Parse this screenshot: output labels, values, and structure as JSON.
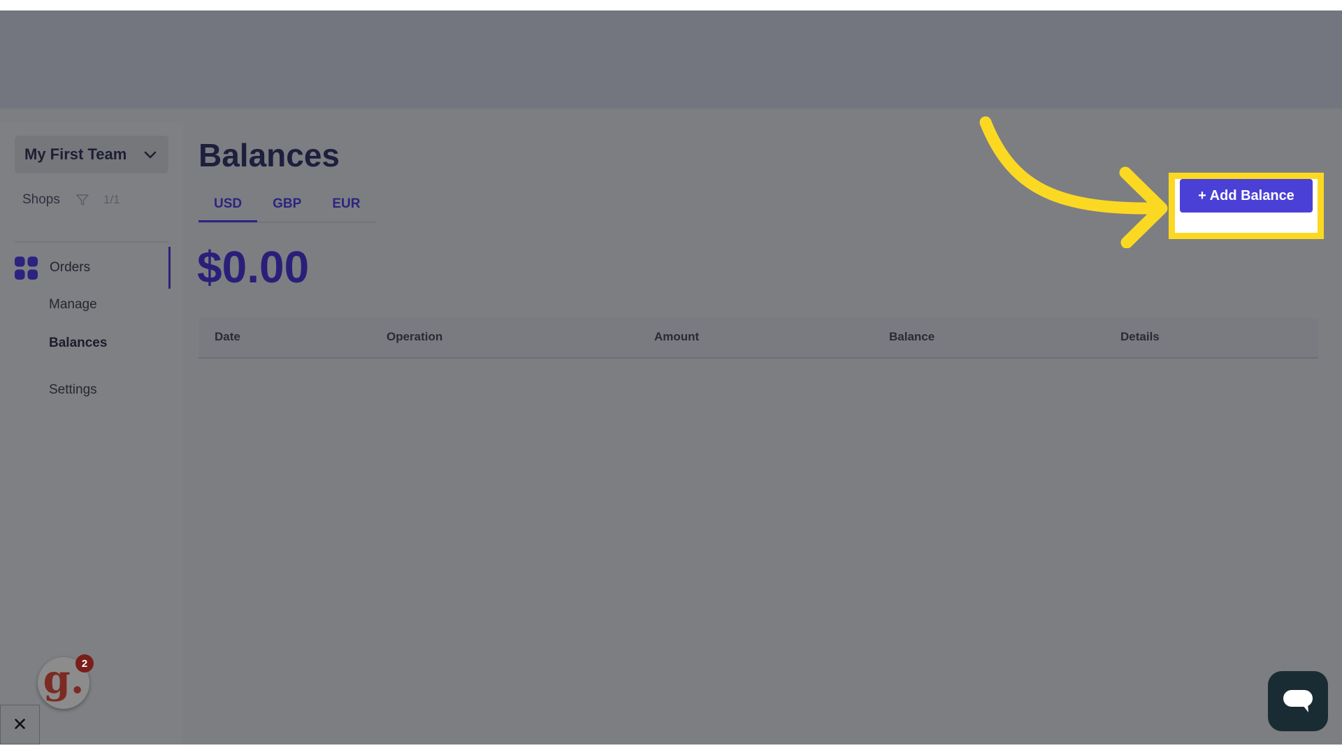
{
  "sidebar": {
    "team_name": "My First Team",
    "shops_label": "Shops",
    "shops_count": "1/1",
    "nav": {
      "orders": "Orders",
      "manage": "Manage",
      "balances": "Balances",
      "settings": "Settings"
    }
  },
  "main": {
    "title": "Balances",
    "tabs": [
      "USD",
      "GBP",
      "EUR"
    ],
    "active_tab": "USD",
    "balance": "$0.00",
    "table": {
      "columns": [
        "Date",
        "Operation",
        "Amount",
        "Balance",
        "Details"
      ]
    },
    "add_button_label": "+ Add Balance"
  },
  "widgets": {
    "avatar_letter": "g.",
    "avatar_badge": "2",
    "close_label": "✕"
  },
  "colors": {
    "accent": "#4b40d6",
    "highlight": "#fbd923",
    "brand_dark": "#2a1f78"
  },
  "icons": {
    "team_chevron": "chevron-down-icon",
    "shops_filter": "filter-icon",
    "orders": "grid-icon",
    "chat": "chat-bubble-icon"
  }
}
